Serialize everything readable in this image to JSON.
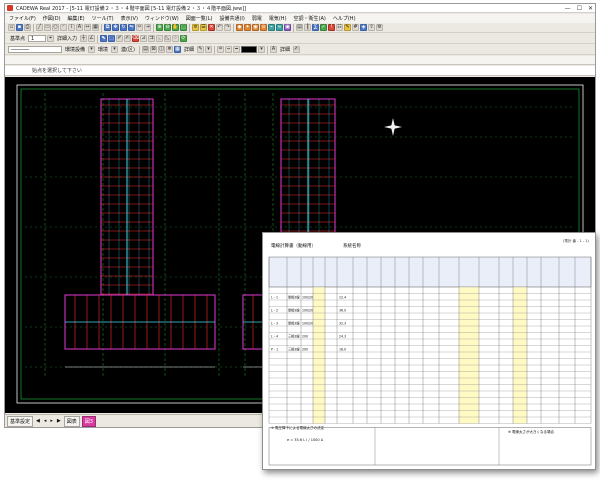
{
  "window": {
    "title": "CADEWA Real 2017 - [5-11 電灯設備２・３・４階平面図 [5-11 電灯設備２・３・４階平面図.jww]]",
    "controls": [
      "—",
      "☐",
      "✕"
    ]
  },
  "menu": [
    "ファイル(F)",
    "作図(D)",
    "編集(E)",
    "ツール(T)",
    "表示(V)",
    "ウィンドウ(W)",
    "図面一覧(L)",
    "設備共通(I)",
    "弱電",
    "電気(H)",
    "空調・衛生(A)",
    "ヘルプ(H)"
  ],
  "toolbar": {
    "scale_label": "基準点",
    "scale_value": "1",
    "input_label": "詳細入力",
    "layer_label": "環境設備",
    "layer_mode": "環境",
    "layer_mode_value": "連(区)",
    "detail_label": "詳細",
    "color_label": "",
    "detail_label2": "詳細"
  },
  "status": {
    "prompt": "始点を選択して下さい"
  },
  "tabs_bottom": {
    "model_tab": "基準設定",
    "page_tab": "図表",
    "active_tab": "図3"
  },
  "sheet": {
    "title": "電線計算書（動線用）",
    "subtitle": "系統名称",
    "page_number": "(電計 番 - 1 - 1)",
    "note1": "※ 電圧降下による電線太さの決定",
    "note2": "※ 電線太さが大きくなる場合",
    "formula": "e = 35.6 L I / 1000 A",
    "rows": [
      {
        "name": "L - 1",
        "type": "単相3線",
        "voltage": "100/200",
        "value": "12.4"
      },
      {
        "name": "L - 2",
        "type": "単相3線",
        "voltage": "100/200",
        "value": "36.0"
      },
      {
        "name": "L - 3",
        "type": "単相3線",
        "voltage": "100/200",
        "value": "32.3"
      },
      {
        "name": "L - 4",
        "type": "三相3線",
        "voltage": "200",
        "value": "24.3"
      },
      {
        "name": "P - 1",
        "type": "三相3線",
        "voltage": "200",
        "value": "18.0"
      }
    ]
  },
  "colors": {
    "canvas_bg": "#000000",
    "frame": "#f0f0f0",
    "green_grid": "#23c23c",
    "building_red": "#ff2a2a",
    "building_magenta": "#e23ad6",
    "building_cyan": "#3fd9e8",
    "sheet_header": "#e9eef8",
    "sheet_highlight": "#fff9c4",
    "active_tab": "#d53c9e"
  },
  "icons": [
    "save-icon",
    "open-icon",
    "print-icon",
    "undo-icon",
    "redo-icon",
    "line-icon",
    "circle-icon",
    "text-icon",
    "dimension-icon",
    "zoom-icon",
    "layer-icon",
    "compass-icon"
  ]
}
